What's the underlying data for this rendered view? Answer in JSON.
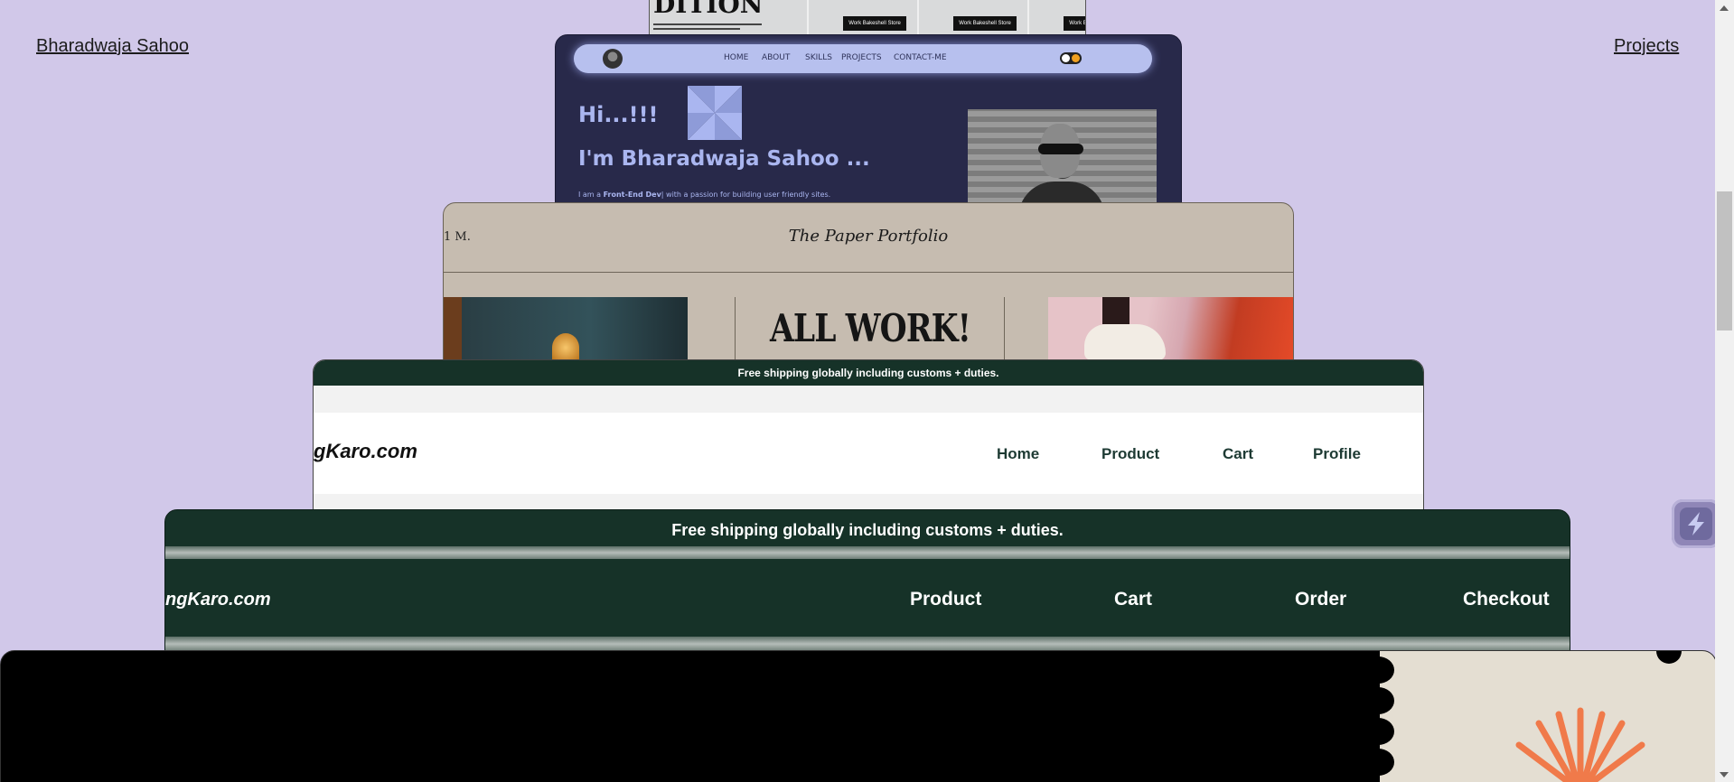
{
  "header": {
    "name_link": "Bharadwaja Sahoo",
    "projects_link": "Projects"
  },
  "card1": {
    "heading": "DITION",
    "shop_buttons": [
      "Work Bakeshell Store",
      "Work Bakeshell Store",
      "Work Bakeshell Store"
    ]
  },
  "card2": {
    "nav": [
      "HOME",
      "ABOUT",
      "SKILLS",
      "PROJECTS",
      "CONTACT-ME"
    ],
    "greeting": "Hi...!!!",
    "intro": "I'm Bharadwaja Sahoo ...",
    "bio_prefix": "I am a ",
    "bio_role": "Front-End Dev",
    "bio_suffix": "| with a passion for building user friendly sites."
  },
  "card3": {
    "brand_left": "1 M.",
    "title": "The Paper Portfolio",
    "hero_text": "ALL WORK!"
  },
  "card4": {
    "shipping": "Free shipping globally including customs + duties.",
    "logo": "gKaro.com",
    "nav": [
      "Home",
      "Product",
      "Cart",
      "Profile"
    ]
  },
  "card5": {
    "shipping": "Free shipping globally including customs + duties.",
    "logo": "ngKaro.com",
    "nav": [
      "Product",
      "Cart",
      "Order",
      "Checkout"
    ]
  },
  "colors": {
    "page_bg": "#d1c8e9",
    "dark_green": "#163228",
    "portfolio_navy": "#28294a",
    "paper": "#c6bcb0"
  },
  "icons": {
    "floating_button": "lightning-icon",
    "hero_shape": "pinwheel-icon"
  }
}
